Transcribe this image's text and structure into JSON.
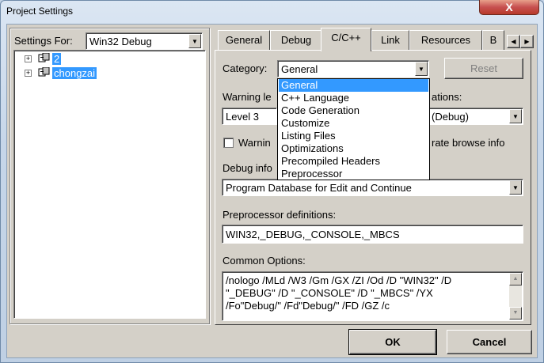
{
  "window": {
    "title": "Project Settings",
    "close_glyph": "X"
  },
  "settings_for": {
    "label": "Settings For:",
    "value": "Win32 Debug"
  },
  "tree": [
    {
      "label": "2",
      "icon": "project-icon"
    },
    {
      "label": "chongzai",
      "icon": "project-icon"
    }
  ],
  "tabs": [
    "General",
    "Debug",
    "C/C++",
    "Link",
    "Resources",
    "B"
  ],
  "active_tab": "C/C++",
  "category": {
    "label": "Category:",
    "value": "General",
    "reset_label": "Reset"
  },
  "dropdown_options": [
    "General",
    "C++ Language",
    "Code Generation",
    "Customize",
    "Listing Files",
    "Optimizations",
    "Precompiled Headers",
    "Preprocessor"
  ],
  "warning_level": {
    "label_visible": "Warning le",
    "value": "Level 3"
  },
  "optimizations": {
    "label_visible": "ations:",
    "value": "(Debug)"
  },
  "warnings_check": {
    "label_visible": "Warnin",
    "checked": false
  },
  "browse_info": {
    "label_visible": "rate browse info"
  },
  "debug_info": {
    "label_visible": "Debug info",
    "value": "Program Database for Edit and Continue"
  },
  "preprocessor": {
    "label": "Preprocessor definitions:",
    "value": "WIN32,_DEBUG,_CONSOLE,_MBCS"
  },
  "common_options": {
    "label": "Common Options:",
    "lines": [
      "/nologo /MLd /W3 /Gm /GX /ZI /Od /D \"WIN32\" /D",
      "\"_DEBUG\" /D \"_CONSOLE\" /D \"_MBCS\" /YX",
      "/Fo\"Debug/\" /Fd\"Debug/\" /FD /GZ /c"
    ]
  },
  "buttons": {
    "ok": "OK",
    "cancel": "Cancel"
  },
  "colors": {
    "selection": "#3399ff",
    "face": "#d4d0c8"
  }
}
